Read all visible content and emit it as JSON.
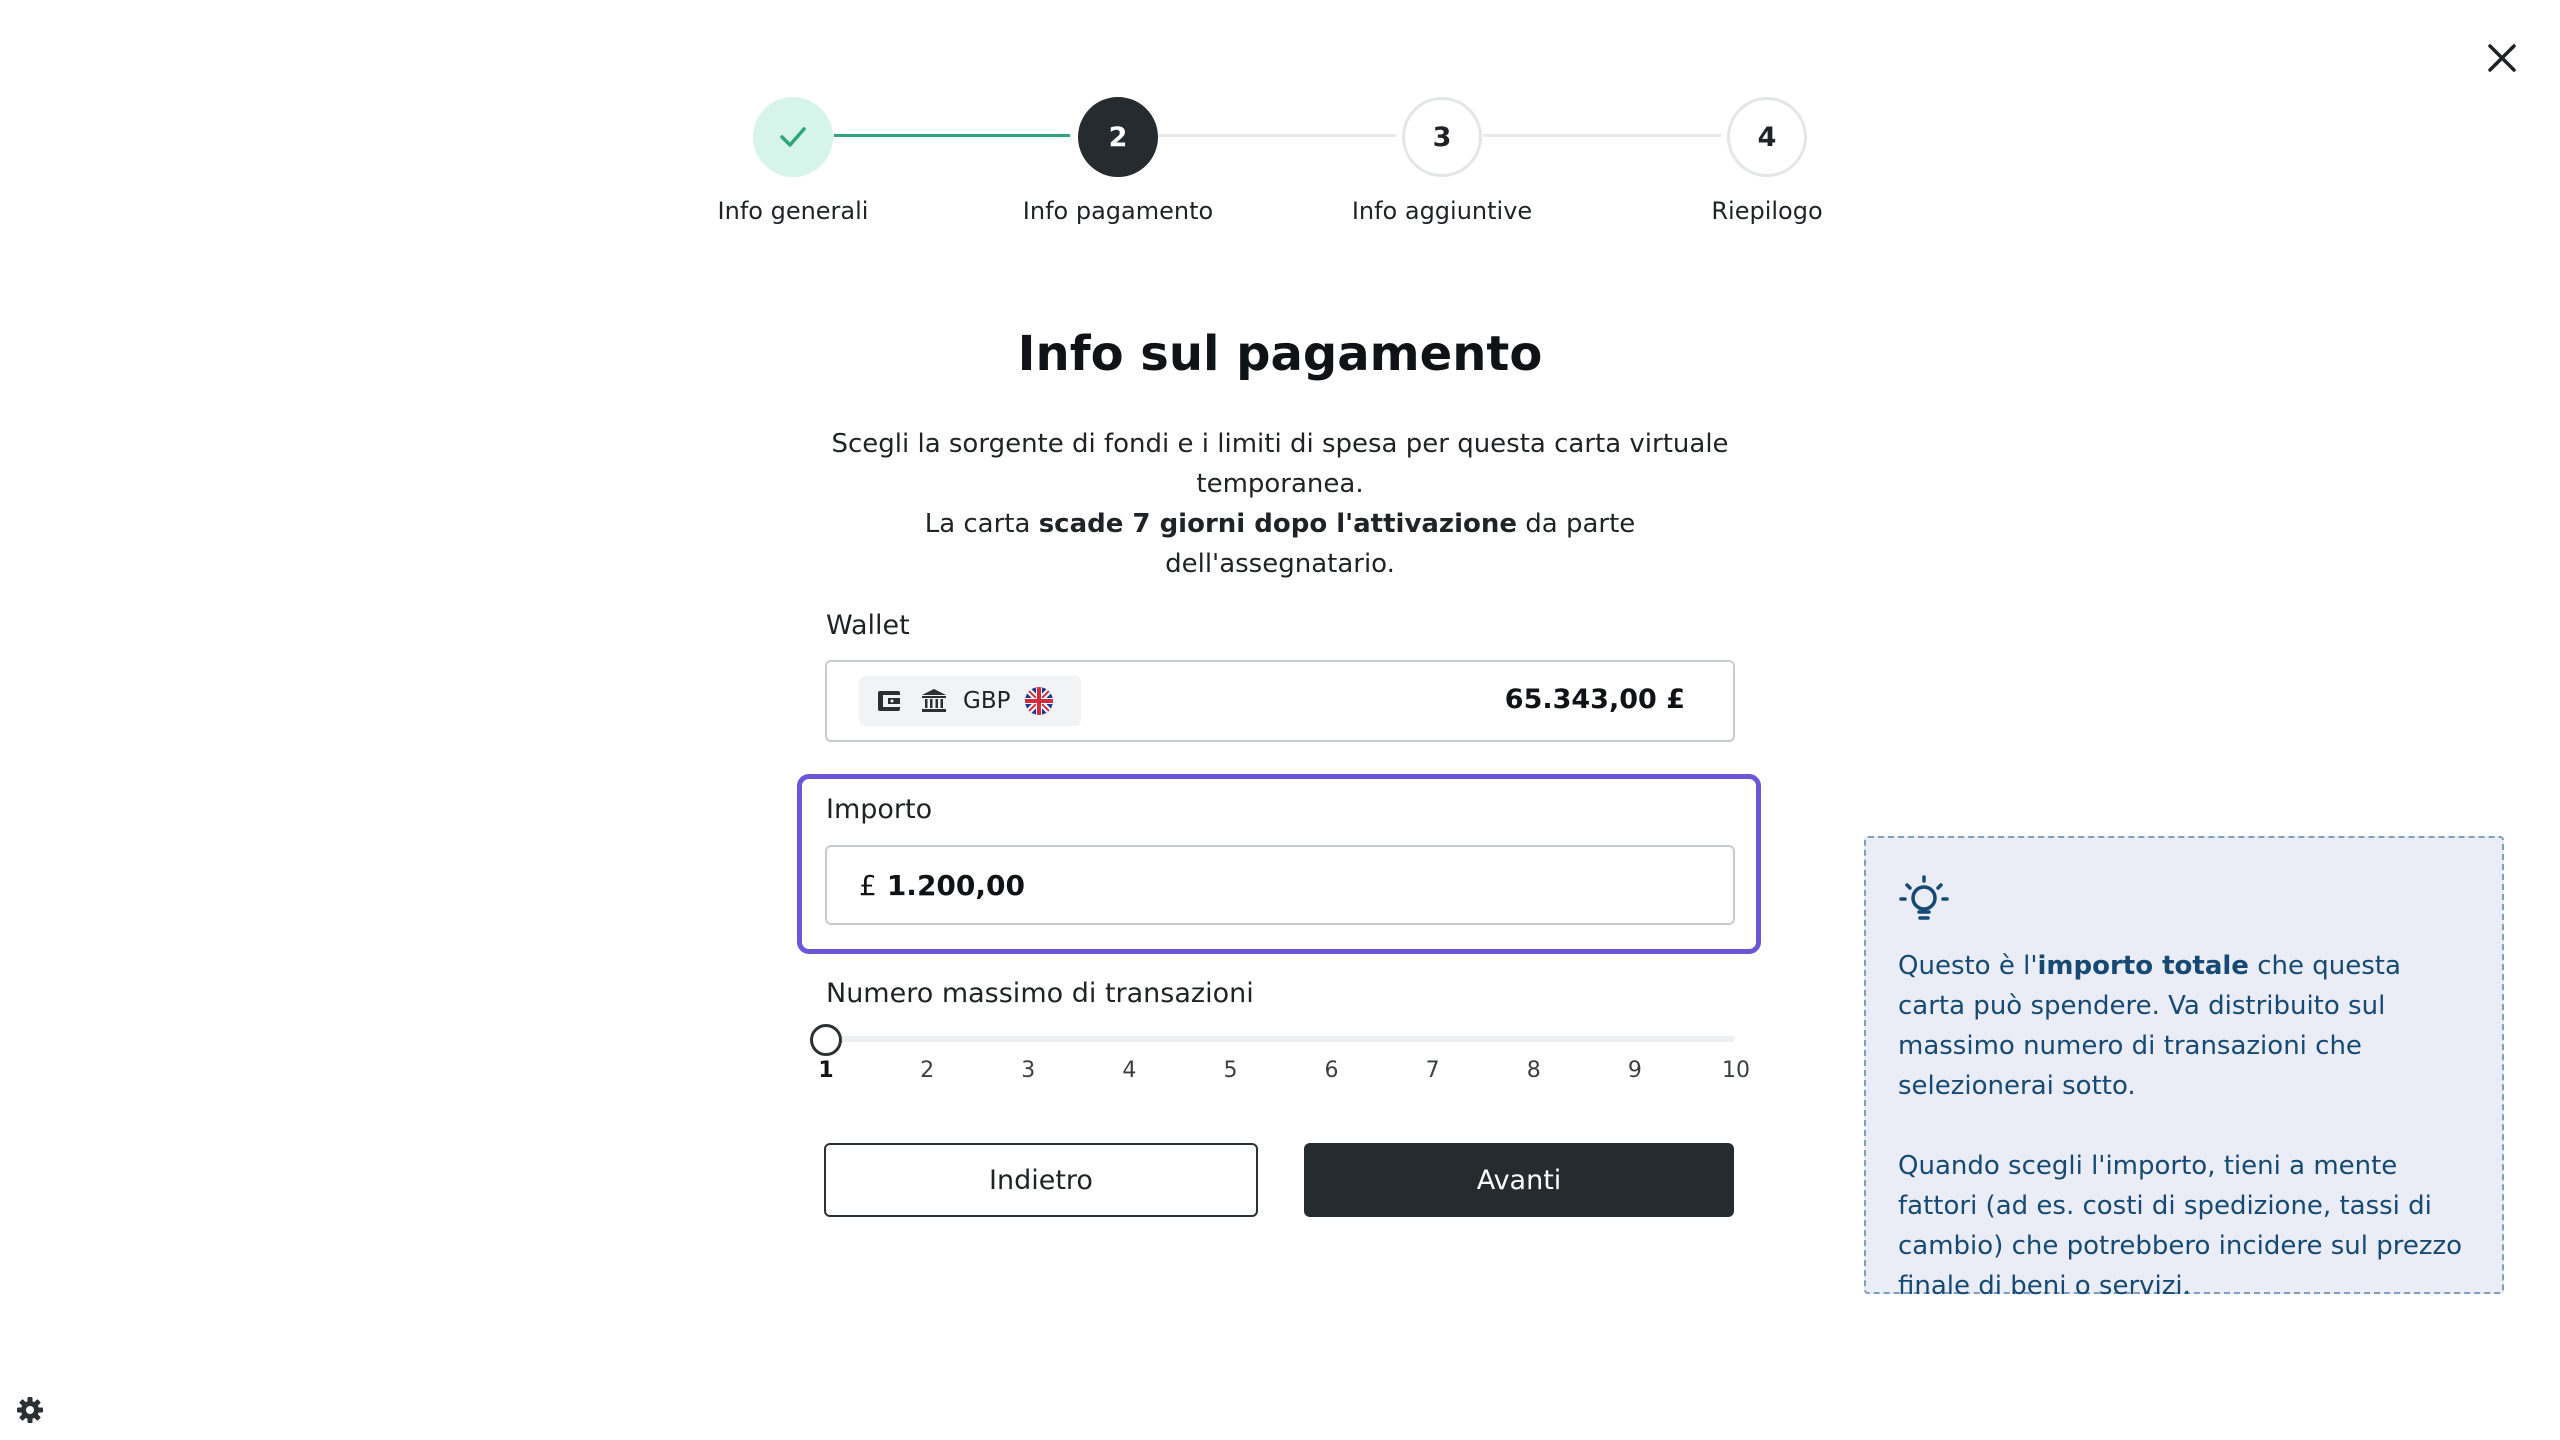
{
  "stepper": {
    "steps": [
      {
        "number": "",
        "label": "Info generali",
        "state": "completed"
      },
      {
        "number": "2",
        "label": "Info pagamento",
        "state": "current"
      },
      {
        "number": "3",
        "label": "Info aggiuntive",
        "state": "upcoming"
      },
      {
        "number": "4",
        "label": "Riepilogo",
        "state": "upcoming"
      }
    ]
  },
  "page": {
    "title": "Info sul pagamento",
    "subtitle_line1": "Scegli la sorgente di fondi e i limiti di spesa per questa carta virtuale temporanea.",
    "subtitle_line2_pre": "La carta ",
    "subtitle_line2_bold": "scade 7 giorni dopo l'attivazione",
    "subtitle_line2_post": " da parte dell'assegnatario."
  },
  "wallet": {
    "label": "Wallet",
    "currency": "GBP",
    "balance": "65.343,00 £",
    "icons": [
      "wallet-icon",
      "bank-icon",
      "uk-flag-icon"
    ]
  },
  "amount": {
    "label": "Importo",
    "currency_symbol": "£",
    "value": "1.200,00"
  },
  "transactions": {
    "label": "Numero massimo di transazioni",
    "selected": 1,
    "min": 1,
    "max": 10,
    "ticks": [
      "1",
      "2",
      "3",
      "4",
      "5",
      "6",
      "7",
      "8",
      "9",
      "10"
    ]
  },
  "buttons": {
    "back": "Indietro",
    "next": "Avanti"
  },
  "tip": {
    "p1_pre": "Questo è l'",
    "p1_bold": "importo totale",
    "p1_post": " che questa carta può spendere. Va distribuito sul massimo numero di transazioni che selezionerai sotto.",
    "p2": "Quando scegli l'importo, tieni a mente fattori (ad es. costi di spedizione, tassi di cambio) che potrebbero incidere sul prezzo finale di beni o servizi."
  },
  "colors": {
    "accent": "#6b55d8",
    "dark": "#252b2e",
    "success": "#2fa67a",
    "tip_text": "#164a74",
    "tip_bg": "#eaecf6"
  }
}
